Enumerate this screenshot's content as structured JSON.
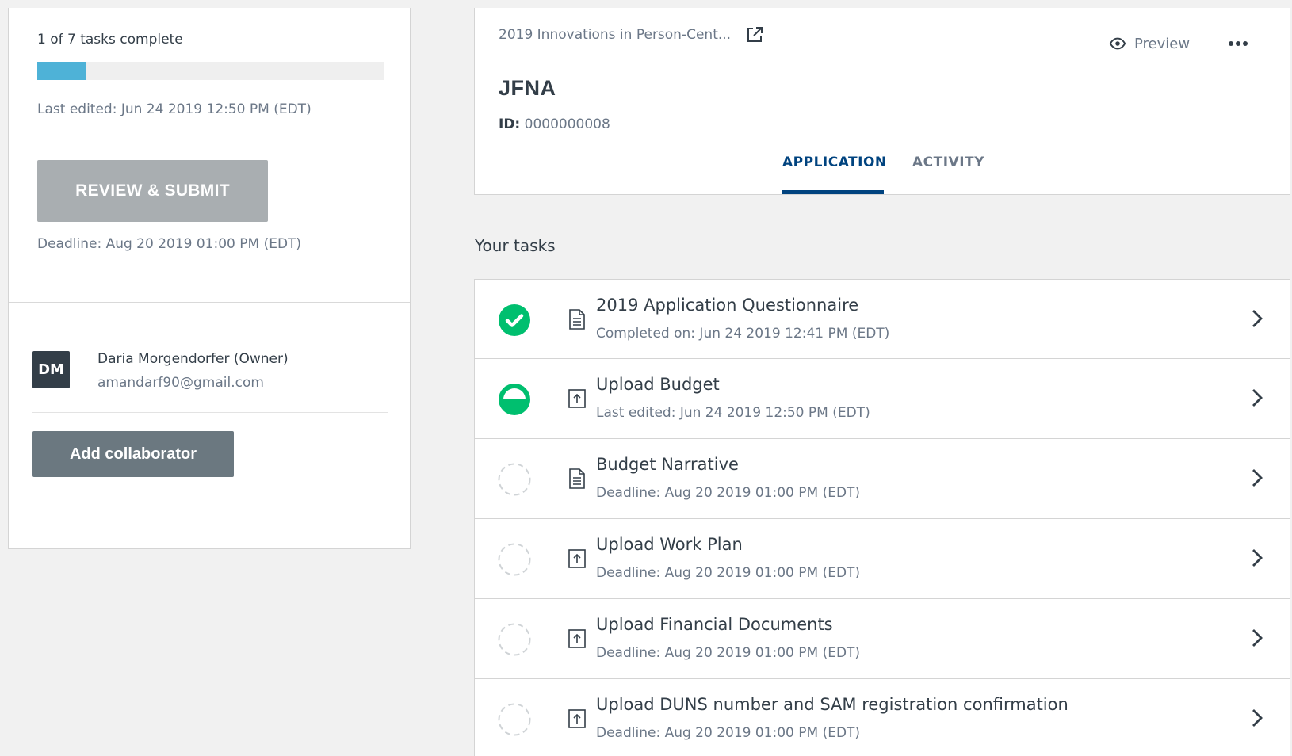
{
  "left_panel": {
    "tasks_complete": "1 of 7 tasks complete",
    "progress_fraction": 0.1429,
    "progress_color": "#4eb2d7",
    "last_edited": "Last edited: Jun 24 2019 12:50 PM (EDT)",
    "review_button": "REVIEW & SUBMIT",
    "deadline": "Deadline: Aug 20 2019 01:00 PM (EDT)",
    "owner": {
      "initials": "DM",
      "name": "Daria Morgendorfer (Owner)",
      "email": "amandarf90@gmail.com"
    },
    "add_collaborator_button": "Add collaborator"
  },
  "header": {
    "breadcrumb": "2019 Innovations in Person-Cent...",
    "external_link_icon": "external-link-icon",
    "preview_label": "Preview",
    "preview_icon": "eye-icon",
    "more_icon": "more-horizontal-icon",
    "org_name": "JFNA",
    "id_label": "ID:",
    "id_value": "0000000008",
    "tabs": [
      {
        "label": "APPLICATION",
        "active": true
      },
      {
        "label": "ACTIVITY",
        "active": false
      }
    ],
    "accent_color": "#00437f"
  },
  "tasks": {
    "heading": "Your tasks",
    "items": [
      {
        "title": "2019 Application Questionnaire",
        "subtitle": "Completed on: Jun 24 2019 12:41 PM (EDT)",
        "status": "complete",
        "type_icon": "document-icon"
      },
      {
        "title": "Upload Budget",
        "subtitle": "Last edited: Jun 24 2019 12:50 PM (EDT)",
        "status": "in-progress",
        "type_icon": "upload-icon"
      },
      {
        "title": "Budget Narrative",
        "subtitle": "Deadline: Aug 20 2019 01:00 PM (EDT)",
        "status": "not-started",
        "type_icon": "document-icon"
      },
      {
        "title": "Upload Work Plan",
        "subtitle": "Deadline: Aug 20 2019 01:00 PM (EDT)",
        "status": "not-started",
        "type_icon": "upload-icon"
      },
      {
        "title": "Upload Financial Documents",
        "subtitle": "Deadline: Aug 20 2019 01:00 PM (EDT)",
        "status": "not-started",
        "type_icon": "upload-icon"
      },
      {
        "title": "Upload DUNS number and SAM registration confirmation",
        "subtitle": "Deadline: Aug 20 2019 01:00 PM (EDT)",
        "status": "not-started",
        "type_icon": "upload-icon"
      }
    ],
    "status_color": "#00bf6f"
  }
}
